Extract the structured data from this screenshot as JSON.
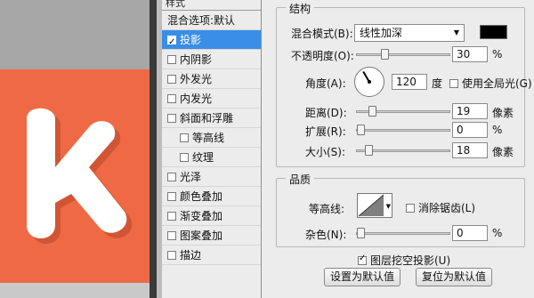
{
  "style_list": {
    "header": "样式",
    "items": [
      {
        "label": "混合选项:默认",
        "has_checkbox": false,
        "checked": false,
        "indent": false,
        "selected": false
      },
      {
        "label": "投影",
        "has_checkbox": true,
        "checked": true,
        "indent": false,
        "selected": true
      },
      {
        "label": "内阴影",
        "has_checkbox": true,
        "checked": false,
        "indent": false,
        "selected": false
      },
      {
        "label": "外发光",
        "has_checkbox": true,
        "checked": false,
        "indent": false,
        "selected": false
      },
      {
        "label": "内发光",
        "has_checkbox": true,
        "checked": false,
        "indent": false,
        "selected": false
      },
      {
        "label": "斜面和浮雕",
        "has_checkbox": true,
        "checked": false,
        "indent": false,
        "selected": false
      },
      {
        "label": "等高线",
        "has_checkbox": true,
        "checked": false,
        "indent": true,
        "selected": false
      },
      {
        "label": "纹理",
        "has_checkbox": true,
        "checked": false,
        "indent": true,
        "selected": false
      },
      {
        "label": "光泽",
        "has_checkbox": true,
        "checked": false,
        "indent": false,
        "selected": false
      },
      {
        "label": "颜色叠加",
        "has_checkbox": true,
        "checked": false,
        "indent": false,
        "selected": false
      },
      {
        "label": "渐变叠加",
        "has_checkbox": true,
        "checked": false,
        "indent": false,
        "selected": false
      },
      {
        "label": "图案叠加",
        "has_checkbox": true,
        "checked": false,
        "indent": false,
        "selected": false
      },
      {
        "label": "描边",
        "has_checkbox": true,
        "checked": false,
        "indent": false,
        "selected": false
      }
    ]
  },
  "structure": {
    "title": "结构",
    "blend_mode_label": "混合模式(B):",
    "blend_mode_value": "线性加深",
    "blend_color": "#000000",
    "opacity_label": "不透明度(O):",
    "opacity_value": "30",
    "opacity_unit": "%",
    "angle_label": "角度(A):",
    "angle_value": "120",
    "angle_unit": "度",
    "global_light_label": "使用全局光(G)",
    "global_light_checked": false,
    "distance_label": "距离(D):",
    "distance_value": "19",
    "distance_unit": "像素",
    "spread_label": "扩展(R):",
    "spread_value": "0",
    "spread_unit": "%",
    "size_label": "大小(S):",
    "size_value": "18",
    "size_unit": "像素"
  },
  "quality": {
    "title": "品质",
    "contour_label": "等高线:",
    "anti_alias_label": "消除锯齿(L)",
    "anti_alias_checked": false,
    "noise_label": "杂色(N):",
    "noise_value": "0",
    "noise_unit": "%"
  },
  "layer_knockout_label": "图层挖空投影(U)",
  "layer_knockout_checked": true,
  "buttons": {
    "set_default": "设置为默认值",
    "reset_default": "复位为默认值"
  },
  "colors": {
    "canvas_orange": "#ef6a44",
    "selection_blue": "#3a8ee6"
  }
}
